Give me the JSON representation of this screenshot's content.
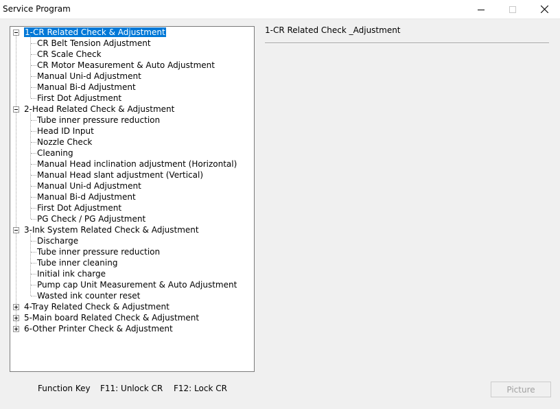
{
  "window": {
    "title": "Service Program"
  },
  "tree": {
    "groups": [
      {
        "label": "1-CR Related Check & Adjustment",
        "expanded": true,
        "selected": true,
        "children": [
          "CR Belt Tension Adjustment",
          "CR Scale Check",
          "CR Motor Measurement & Auto  Adjustment",
          "Manual Uni-d Adjustment",
          "Manual Bi-d Adjustment",
          "First Dot Adjustment"
        ]
      },
      {
        "label": "2-Head Related Check & Adjustment",
        "expanded": true,
        "children": [
          "Tube inner pressure reduction",
          "Head ID Input",
          "Nozzle Check",
          "Cleaning",
          "Manual Head inclination adjustment (Horizontal)",
          "Manual Head slant adjustment (Vertical)",
          "Manual Uni-d Adjustment",
          "Manual Bi-d Adjustment",
          "First Dot Adjustment",
          "PG Check / PG Adjustment"
        ]
      },
      {
        "label": "3-Ink System Related Check & Adjustment",
        "expanded": true,
        "children": [
          "Discharge",
          "Tube inner pressure reduction",
          "Tube inner cleaning",
          "Initial ink charge",
          "Pump cap Unit Measurement & Auto Adjustment",
          "Wasted ink counter reset"
        ]
      },
      {
        "label": "4-Tray Related Check & Adjustment",
        "expanded": false,
        "children": []
      },
      {
        "label": "5-Main board Related Check & Adjustment",
        "expanded": false,
        "children": []
      },
      {
        "label": "6-Other Printer Check & Adjustment",
        "expanded": false,
        "children": []
      }
    ]
  },
  "detail": {
    "title": "1-CR Related Check _Adjustment"
  },
  "footer": {
    "function_key_label": "Function Key",
    "f11_label": "F11: Unlock CR",
    "f12_label": "F12: Lock CR",
    "picture_button_label": "Picture"
  },
  "colors": {
    "selection": "#0078d7",
    "window_bg": "#f0f0f0"
  }
}
